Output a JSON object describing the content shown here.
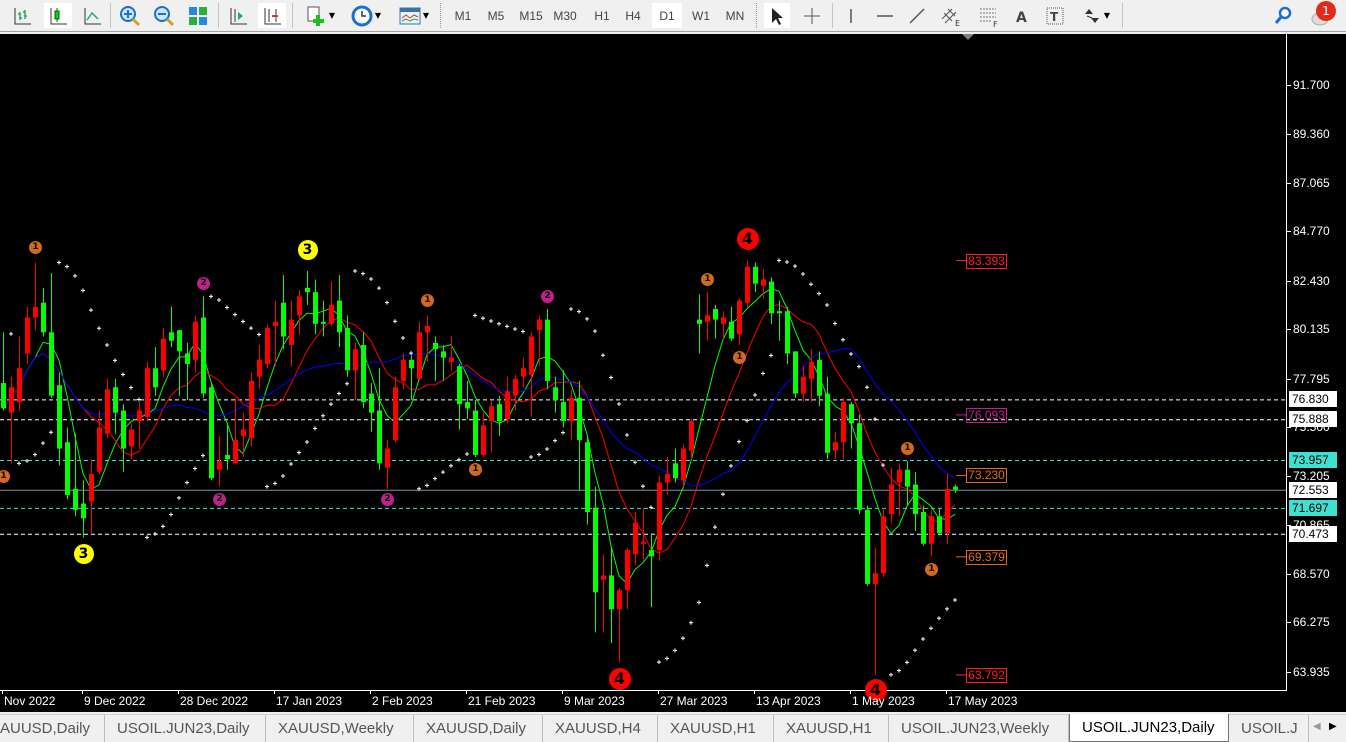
{
  "toolbar": {
    "timeframes": [
      "M1",
      "M5",
      "M15",
      "M30",
      "H1",
      "H4",
      "D1",
      "W1",
      "MN"
    ],
    "active_timeframe": "D1",
    "notification_count": "1"
  },
  "price_axis": {
    "ticks": [
      "91.700",
      "89.360",
      "87.065",
      "84.770",
      "82.430",
      "80.135",
      "77.795",
      "75.500",
      "73.205",
      "70.865",
      "68.570",
      "66.275",
      "63.935"
    ],
    "tags": [
      {
        "value": "76.830",
        "style": "white"
      },
      {
        "value": "75.888",
        "style": "white"
      },
      {
        "value": "73.957",
        "style": "cyan"
      },
      {
        "value": "72.553",
        "style": "white"
      },
      {
        "value": "71.697",
        "style": "cyan"
      },
      {
        "value": "70.473",
        "style": "white"
      }
    ]
  },
  "level_boxes": [
    {
      "value": "83.393",
      "color": "#ff2020"
    },
    {
      "value": "76.093",
      "color": "#c0208c"
    },
    {
      "value": "73.230",
      "color": "#e06a1a"
    },
    {
      "value": "69.379",
      "color": "#e06a1a"
    },
    {
      "value": "63.792",
      "color": "#ff2020"
    }
  ],
  "tabs": [
    "AUUSD,Daily",
    "USOIL.JUN23,Daily",
    "XAUUSD,Weekly",
    "XAUUSD,Daily",
    "XAUUSD,H4",
    "XAUUSD,H1",
    "XAUUSD,H1",
    "USOIL.JUN23,Weekly",
    "USOIL.JUN23,Daily",
    "USOIL.J"
  ],
  "active_tab": 8,
  "colors": {
    "bull": "#ff0000",
    "bear": "#00ff00",
    "ma_fast": "#00ff00",
    "ma_mid": "#ff0000",
    "ma_slow": "#0000ff",
    "cyan": "#40e0d0"
  },
  "chart_data": {
    "type": "candlestick",
    "symbol": "USOIL.JUN23",
    "timeframe": "Daily",
    "ylim": [
      63.08,
      94.11
    ],
    "x_labels": [
      {
        "bar": 0,
        "text": "Nov 2022"
      },
      {
        "bar": 10,
        "text": "9 Dec 2022"
      },
      {
        "bar": 22,
        "text": "28 Dec 2022"
      },
      {
        "bar": 34,
        "text": "17 Jan 2023"
      },
      {
        "bar": 46,
        "text": "2 Feb 2023"
      },
      {
        "bar": 58,
        "text": "21 Feb 2023"
      },
      {
        "bar": 70,
        "text": "9 Mar 2023"
      },
      {
        "bar": 82,
        "text": "27 Mar 2023"
      },
      {
        "bar": 94,
        "text": "13 Apr 2023"
      },
      {
        "bar": 106,
        "text": "1 May 2023"
      },
      {
        "bar": 118,
        "text": "17 May 2023"
      }
    ],
    "hlines": [
      {
        "price": 76.83,
        "style": "white-dash"
      },
      {
        "price": 75.888,
        "style": "white-dash"
      },
      {
        "price": 73.957,
        "style": "cyan-dash"
      },
      {
        "price": 72.553,
        "style": "gray-solid"
      },
      {
        "price": 71.697,
        "style": "cyan-dash"
      },
      {
        "price": 70.473,
        "style": "white-dash"
      }
    ],
    "level_prices": [
      83.393,
      76.093,
      73.23,
      69.379,
      63.792
    ],
    "ma_periods": [
      5,
      10,
      20
    ],
    "ohlc": [
      [
        77.6,
        80.0,
        76.3,
        76.4
      ],
      [
        76.2,
        77.9,
        73.8,
        77.4
      ],
      [
        76.7,
        79.8,
        76.3,
        78.3
      ],
      [
        79.0,
        81.2,
        78.5,
        80.7
      ],
      [
        80.7,
        83.3,
        80.1,
        81.2
      ],
      [
        81.4,
        82.1,
        79.8,
        80.0
      ],
      [
        80.0,
        82.8,
        76.9,
        77.0
      ],
      [
        77.5,
        78.1,
        73.7,
        74.5
      ],
      [
        74.8,
        75.5,
        72.1,
        72.3
      ],
      [
        72.6,
        75.2,
        71.3,
        71.6
      ],
      [
        71.9,
        73.0,
        70.3,
        71.2
      ],
      [
        72.0,
        74.0,
        70.5,
        73.3
      ],
      [
        73.4,
        76.3,
        73.3,
        75.5
      ],
      [
        75.2,
        77.8,
        75.0,
        77.3
      ],
      [
        77.4,
        77.8,
        75.2,
        76.2
      ],
      [
        76.3,
        76.6,
        73.4,
        74.5
      ],
      [
        74.6,
        75.7,
        74.0,
        75.4
      ],
      [
        75.8,
        76.7,
        74.5,
        76.3
      ],
      [
        76.0,
        78.6,
        75.8,
        78.3
      ],
      [
        78.3,
        79.3,
        77.0,
        77.4
      ],
      [
        78.2,
        80.2,
        77.9,
        79.7
      ],
      [
        80.0,
        81.2,
        79.3,
        79.6
      ],
      [
        80.1,
        80.1,
        77.0,
        79.1
      ],
      [
        79.0,
        79.5,
        76.8,
        78.5
      ],
      [
        78.7,
        80.8,
        78.1,
        80.5
      ],
      [
        80.7,
        81.7,
        76.9,
        77.1
      ],
      [
        77.4,
        77.6,
        73.0,
        73.1
      ],
      [
        73.5,
        75.1,
        72.7,
        73.9
      ],
      [
        74.2,
        75.7,
        73.5,
        74.0
      ],
      [
        73.8,
        76.9,
        73.8,
        74.9
      ],
      [
        75.1,
        76.2,
        74.1,
        75.4
      ],
      [
        75.0,
        78.1,
        74.6,
        77.7
      ],
      [
        77.9,
        79.4,
        77.3,
        78.7
      ],
      [
        78.5,
        80.4,
        78.3,
        80.2
      ],
      [
        80.3,
        81.5,
        78.4,
        80.5
      ],
      [
        81.4,
        82.7,
        79.2,
        79.8
      ],
      [
        79.4,
        81.5,
        78.4,
        80.6
      ],
      [
        80.8,
        82.0,
        79.9,
        81.7
      ],
      [
        82.1,
        82.9,
        81.3,
        81.9
      ],
      [
        81.9,
        82.5,
        79.9,
        80.4
      ],
      [
        80.5,
        81.5,
        79.8,
        80.4
      ],
      [
        80.4,
        82.4,
        80.3,
        81.3
      ],
      [
        81.5,
        82.7,
        79.3,
        80.0
      ],
      [
        80.2,
        80.8,
        77.9,
        78.2
      ],
      [
        78.2,
        79.5,
        76.8,
        79.2
      ],
      [
        79.4,
        80.0,
        76.4,
        76.7
      ],
      [
        77.1,
        77.6,
        75.3,
        76.2
      ],
      [
        76.3,
        78.3,
        73.5,
        73.8
      ],
      [
        73.6,
        74.9,
        72.6,
        74.5
      ],
      [
        74.9,
        77.9,
        74.8,
        77.4
      ],
      [
        77.7,
        79.0,
        77.3,
        78.7
      ],
      [
        78.7,
        78.9,
        76.8,
        78.3
      ],
      [
        77.8,
        80.5,
        77.7,
        80.0
      ],
      [
        80.0,
        80.8,
        78.6,
        80.3
      ],
      [
        79.5,
        79.8,
        77.7,
        79.2
      ],
      [
        79.1,
        79.4,
        77.7,
        78.8
      ],
      [
        78.6,
        79.8,
        78.2,
        78.8
      ],
      [
        78.4,
        78.5,
        75.4,
        76.6
      ],
      [
        76.7,
        77.7,
        75.9,
        76.4
      ],
      [
        76.3,
        76.8,
        74.1,
        74.2
      ],
      [
        74.2,
        76.2,
        74.1,
        75.6
      ],
      [
        75.8,
        76.8,
        74.3,
        76.5
      ],
      [
        76.6,
        77.0,
        75.1,
        75.8
      ],
      [
        75.9,
        77.9,
        75.7,
        77.2
      ],
      [
        77.0,
        78.0,
        76.3,
        77.8
      ],
      [
        77.9,
        78.8,
        77.4,
        78.3
      ],
      [
        78.0,
        80.0,
        76.0,
        79.8
      ],
      [
        80.1,
        80.8,
        78.4,
        80.6
      ],
      [
        80.6,
        81.1,
        77.3,
        77.7
      ],
      [
        77.4,
        77.9,
        76.2,
        76.8
      ],
      [
        76.7,
        78.2,
        75.5,
        75.8
      ],
      [
        75.8,
        77.3,
        74.9,
        76.9
      ],
      [
        76.9,
        77.7,
        72.5,
        74.9
      ],
      [
        74.8,
        75.1,
        70.9,
        71.5
      ],
      [
        71.7,
        72.7,
        65.8,
        67.7
      ],
      [
        68.3,
        69.5,
        65.8,
        68.5
      ],
      [
        68.5,
        69.8,
        65.3,
        66.9
      ],
      [
        66.9,
        67.9,
        64.4,
        67.8
      ],
      [
        67.8,
        69.8,
        66.9,
        69.7
      ],
      [
        69.5,
        71.5,
        69.0,
        71.0
      ],
      [
        70.0,
        71.7,
        69.2,
        70.1
      ],
      [
        69.7,
        70.5,
        67.0,
        69.4
      ],
      [
        69.7,
        73.2,
        69.2,
        72.9
      ],
      [
        72.9,
        74.1,
        72.3,
        73.3
      ],
      [
        73.8,
        74.5,
        72.9,
        73.1
      ],
      [
        73.0,
        74.7,
        72.7,
        74.5
      ],
      [
        74.4,
        75.9,
        74.0,
        75.8
      ],
      [
        80.6,
        81.8,
        79.0,
        80.4
      ],
      [
        80.5,
        81.9,
        79.6,
        80.8
      ],
      [
        81.1,
        81.3,
        79.7,
        80.6
      ],
      [
        80.4,
        81.0,
        79.7,
        80.7
      ],
      [
        80.5,
        81.2,
        79.6,
        79.7
      ],
      [
        79.9,
        81.6,
        79.4,
        81.5
      ],
      [
        81.4,
        83.4,
        81.2,
        83.1
      ],
      [
        83.1,
        83.3,
        81.9,
        82.3
      ],
      [
        82.2,
        83.0,
        81.6,
        82.5
      ],
      [
        82.4,
        82.6,
        80.4,
        80.9
      ],
      [
        81.0,
        81.5,
        79.6,
        80.9
      ],
      [
        81.0,
        81.2,
        78.5,
        79.0
      ],
      [
        79.1,
        79.1,
        76.9,
        77.1
      ],
      [
        77.1,
        78.4,
        76.7,
        77.9
      ],
      [
        77.8,
        79.2,
        76.7,
        78.6
      ],
      [
        78.7,
        79.1,
        76.5,
        77.0
      ],
      [
        77.1,
        77.9,
        74.0,
        74.3
      ],
      [
        74.4,
        75.3,
        74.0,
        74.8
      ],
      [
        74.8,
        76.9,
        74.0,
        76.7
      ],
      [
        76.6,
        76.7,
        74.5,
        75.7
      ],
      [
        75.7,
        76.1,
        71.4,
        71.6
      ],
      [
        71.6,
        71.8,
        68.0,
        68.1
      ],
      [
        68.1,
        69.8,
        63.8,
        68.6
      ],
      [
        68.6,
        71.7,
        68.4,
        71.3
      ],
      [
        71.4,
        73.6,
        71.0,
        72.8
      ],
      [
        72.9,
        73.8,
        71.3,
        73.5
      ],
      [
        73.5,
        73.9,
        71.8,
        72.7
      ],
      [
        72.8,
        73.4,
        70.6,
        71.4
      ],
      [
        71.5,
        71.8,
        69.9,
        70.0
      ],
      [
        70.0,
        71.6,
        69.4,
        71.3
      ],
      [
        71.3,
        71.7,
        70.4,
        70.5
      ],
      [
        70.5,
        73.3,
        70.0,
        72.6
      ],
      [
        72.7,
        72.8,
        72.4,
        72.553
      ]
    ],
    "markers": [
      {
        "bar": 4,
        "price": 84.0,
        "label": "1",
        "color": "#d2691e"
      },
      {
        "bar": 0,
        "price": 73.2,
        "label": "1",
        "color": "#d2691e"
      },
      {
        "bar": 38,
        "price": 83.9,
        "label": "3",
        "color": "#ffff00"
      },
      {
        "bar": 10,
        "price": 69.5,
        "label": "3",
        "color": "#ffff00"
      },
      {
        "bar": 25,
        "price": 82.3,
        "label": "2",
        "color": "#c0208c"
      },
      {
        "bar": 27,
        "price": 72.1,
        "label": "2",
        "color": "#c0208c"
      },
      {
        "bar": 48,
        "price": 72.1,
        "label": "2",
        "color": "#c0208c"
      },
      {
        "bar": 53,
        "price": 81.5,
        "label": "1",
        "color": "#d2691e"
      },
      {
        "bar": 59,
        "price": 73.5,
        "label": "1",
        "color": "#d2691e"
      },
      {
        "bar": 68,
        "price": 81.7,
        "label": "2",
        "color": "#c0208c"
      },
      {
        "bar": 77,
        "price": 63.6,
        "label": "4",
        "color": "#ff0000"
      },
      {
        "bar": 88,
        "price": 82.5,
        "label": "1",
        "color": "#d2691e"
      },
      {
        "bar": 92,
        "price": 78.8,
        "label": "1",
        "color": "#d2691e"
      },
      {
        "bar": 93,
        "price": 84.4,
        "label": "4",
        "color": "#ff0000"
      },
      {
        "bar": 113,
        "price": 74.5,
        "label": "1",
        "color": "#d2691e"
      },
      {
        "bar": 116,
        "price": 68.8,
        "label": "1",
        "color": "#d2691e"
      },
      {
        "bar": 109,
        "price": 63.1,
        "label": "4",
        "color": "#ff0000"
      }
    ]
  }
}
